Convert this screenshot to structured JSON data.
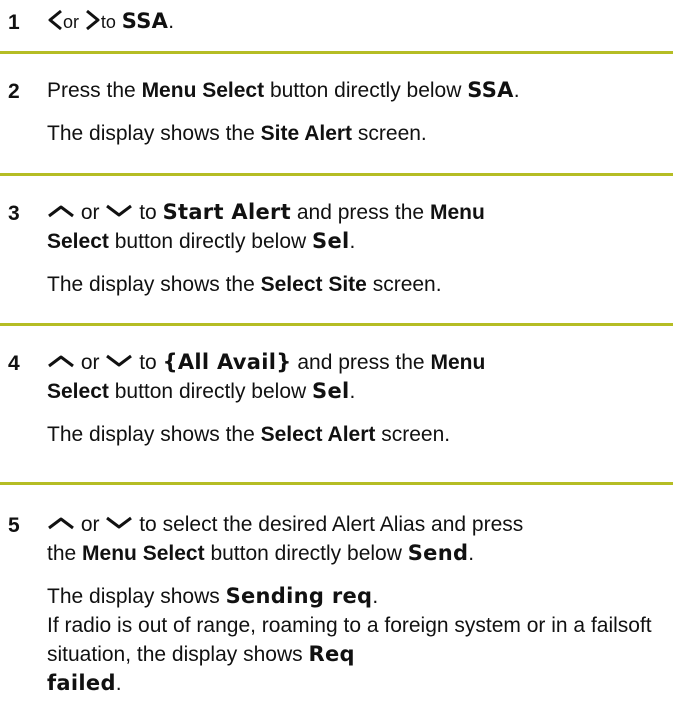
{
  "steps": [
    {
      "number": "1",
      "or": "or",
      "to": "to",
      "target": "SSA",
      "period": ".",
      "icons": [
        "left-arrow-icon",
        "right-arrow-icon"
      ]
    },
    {
      "number": "2",
      "press": "Press the",
      "button": "Menu Select",
      "below": "button directly below",
      "softkey": "SSA",
      "period": ".",
      "shows": "The display shows the",
      "screen_name": "Site Alert",
      "screen": "screen."
    },
    {
      "number": "3",
      "or": "or",
      "to": "to",
      "target": "Start Alert",
      "and_press": "and press the",
      "button_line1": "Menu",
      "button_line2": "Select",
      "below": "button directly below",
      "softkey": "Sel",
      "period": ".",
      "shows": "The display shows the",
      "screen_name": "Select Site",
      "screen": "screen.",
      "icons": [
        "up-arrow-icon",
        "down-arrow-icon"
      ]
    },
    {
      "number": "4",
      "or": "or",
      "to": "to",
      "target": "{All Avail}",
      "and_press": "and press the",
      "button_line1": "Menu",
      "button_line2": "Select",
      "below": "button directly below",
      "softkey": "Sel",
      "period": ".",
      "shows": "The display shows the",
      "screen_name": "Select Alert",
      "screen": "screen.",
      "icons": [
        "up-arrow-icon",
        "down-arrow-icon"
      ]
    },
    {
      "number": "5",
      "or": "or",
      "line1_rest": "to select the desired Alert Alias and press",
      "the": "the",
      "button": "Menu Select",
      "below": "button directly below",
      "softkey": "Send",
      "period": ".",
      "shows": "The display shows",
      "display_text": "Sending req",
      "out_of_range": "If radio is out of range, roaming to a foreign system or in a failsoft situation, the display shows",
      "failed_line1": "Req",
      "failed_line2": "failed",
      "icons": [
        "up-arrow-icon",
        "down-arrow-icon"
      ]
    }
  ],
  "colors": {
    "rule": "#b5bd24",
    "text": "#111111"
  }
}
